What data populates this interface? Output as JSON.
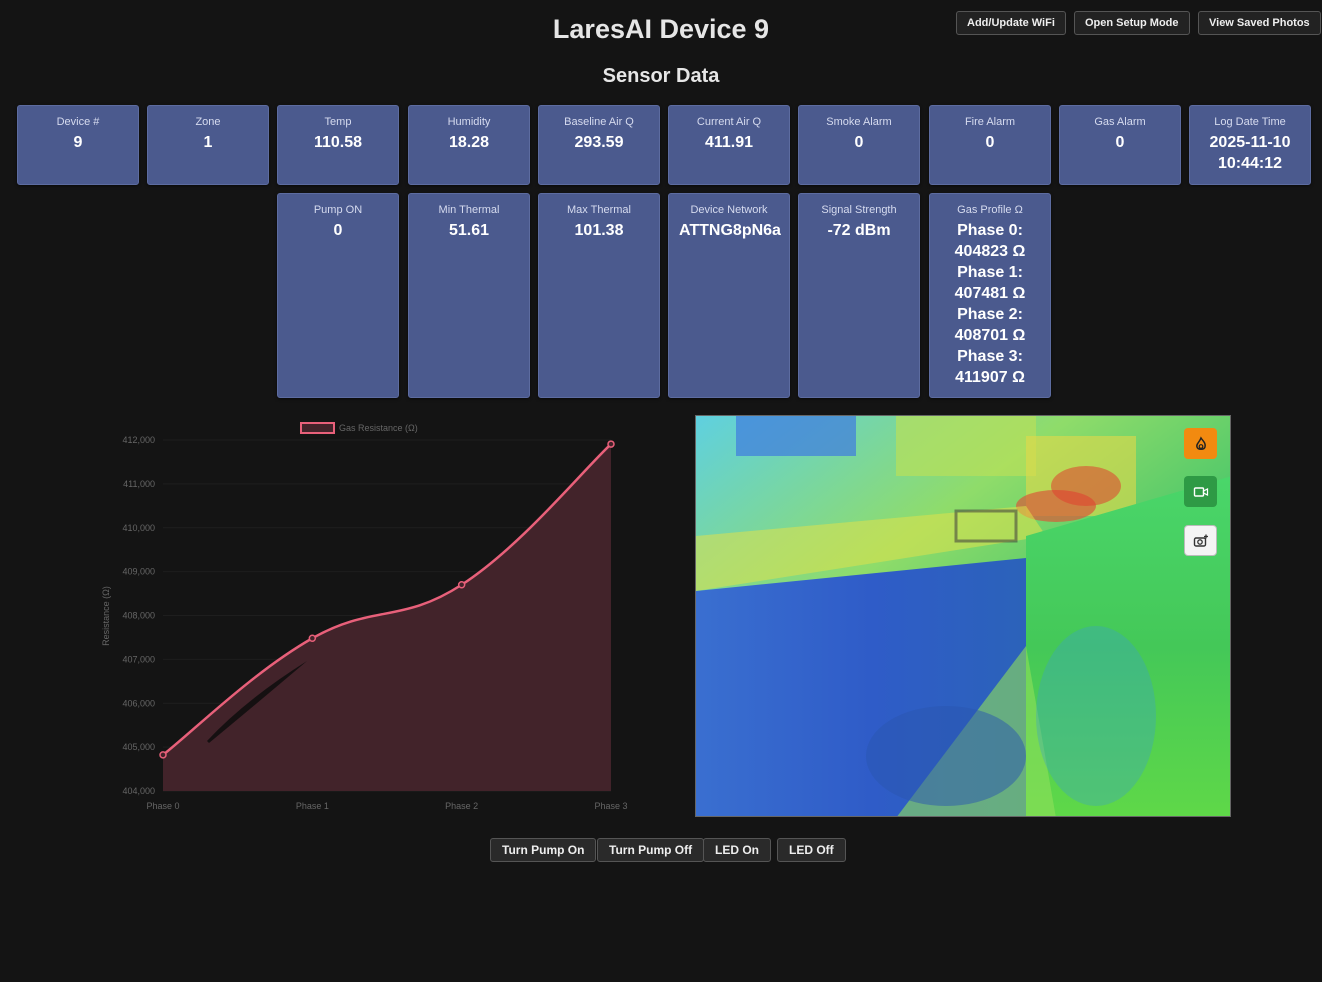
{
  "header": {
    "title": "LaresAI Device 9",
    "subtitle": "Sensor Data",
    "buttons": {
      "wifi": "Add/Update WiFi",
      "setup": "Open Setup Mode",
      "photos": "View Saved Photos"
    }
  },
  "cards": {
    "device": {
      "label": "Device #",
      "value": "9"
    },
    "zone": {
      "label": "Zone",
      "value": "1"
    },
    "temp": {
      "label": "Temp",
      "value": "110.58"
    },
    "humidity": {
      "label": "Humidity",
      "value": "18.28"
    },
    "baseline": {
      "label": "Baseline Air Q",
      "value": "293.59"
    },
    "current": {
      "label": "Current Air Q",
      "value": "411.91"
    },
    "smoke": {
      "label": "Smoke Alarm",
      "value": "0"
    },
    "fire": {
      "label": "Fire Alarm",
      "value": "0"
    },
    "gas": {
      "label": "Gas Alarm",
      "value": "0"
    },
    "logtime": {
      "label": "Log Date Time",
      "value": "2025-11-10 10:44:12"
    },
    "pump": {
      "label": "Pump ON",
      "value": "0"
    },
    "minthermal": {
      "label": "Min Thermal",
      "value": "51.61"
    },
    "maxthermal": {
      "label": "Max Thermal",
      "value": "101.38"
    },
    "network": {
      "label": "Device Network",
      "value": "ATTNG8pN6a"
    },
    "signal": {
      "label": "Signal Strength",
      "value": "-72 dBm"
    },
    "gasprofile": {
      "label": "Gas Profile Ω",
      "value": "Phase 0: 404823 Ω Phase 1: 407481 Ω Phase 2: 408701 Ω Phase 3: 411907 Ω"
    }
  },
  "chart_data": {
    "type": "area",
    "categories": [
      "Phase 0",
      "Phase 1",
      "Phase 2",
      "Phase 3"
    ],
    "series": [
      {
        "name": "Gas Resistance (Ω)",
        "values": [
          404823,
          407481,
          408701,
          411907
        ]
      }
    ],
    "ylabel": "Resistance (Ω)",
    "ylim": [
      404000,
      412000
    ],
    "yticks": [
      404000,
      405000,
      406000,
      407000,
      408000,
      409000,
      410000,
      411000,
      412000
    ],
    "ytick_labels": [
      "404,000",
      "405,000",
      "406,000",
      "407,000",
      "408,000",
      "409,000",
      "410,000",
      "411,000",
      "412,000"
    ],
    "legend": "top",
    "colors": {
      "line": "#e8607a",
      "fill": "#42232a"
    }
  },
  "thermal": {
    "buttons": [
      {
        "icon": "fire-icon",
        "color": "#f28a10"
      },
      {
        "icon": "video-icon",
        "color": "#2e9a45"
      },
      {
        "icon": "camera-add-icon",
        "color": "#f4f4f4"
      }
    ]
  },
  "controls": {
    "pump_on": "Turn Pump On",
    "pump_off": "Turn Pump Off",
    "led_on": "LED On",
    "led_off": "LED Off"
  }
}
